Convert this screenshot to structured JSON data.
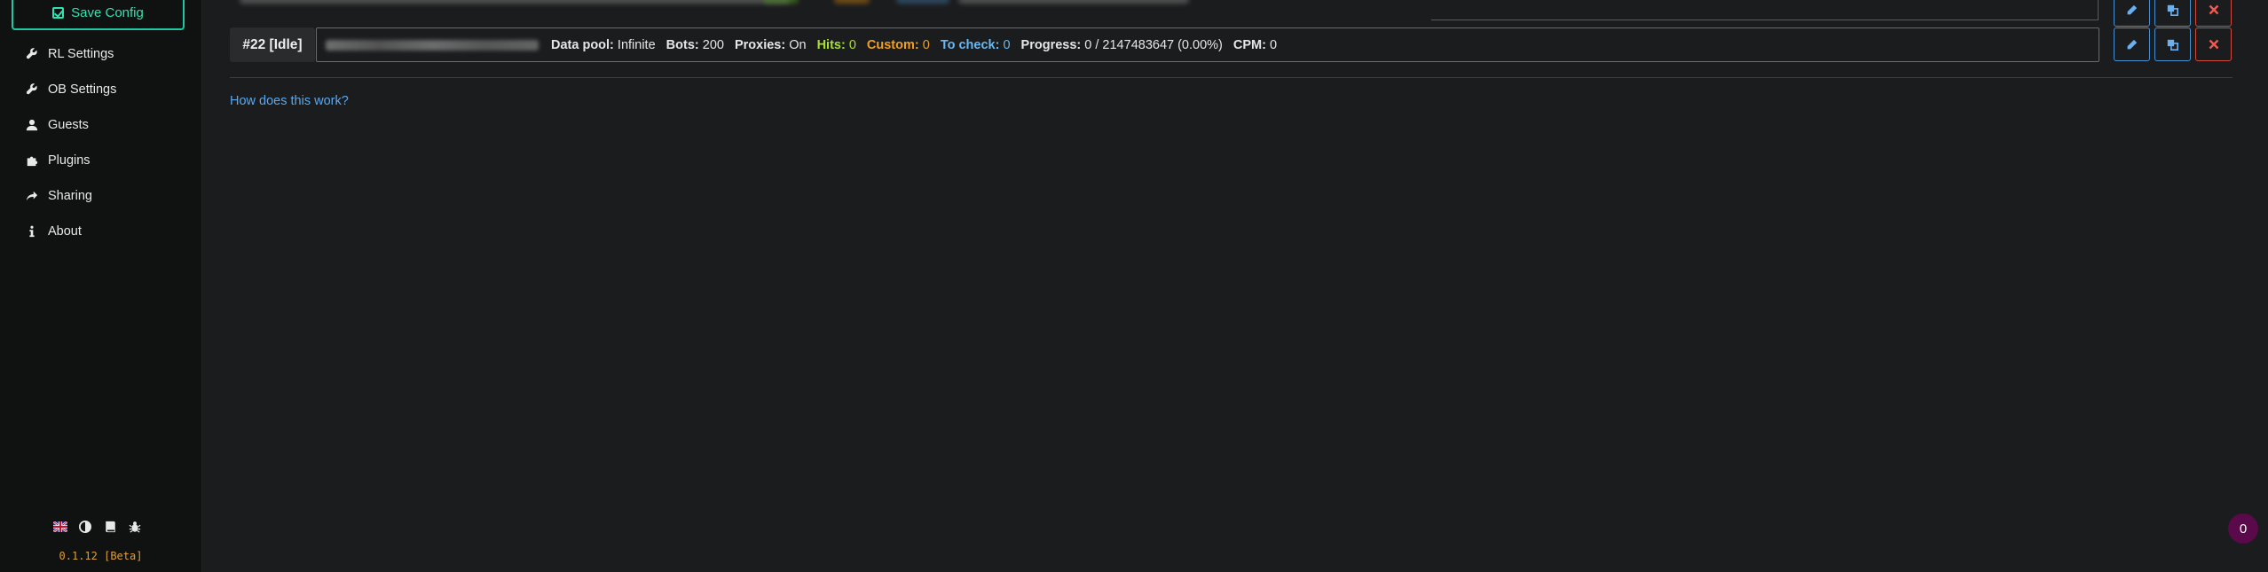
{
  "sidebar": {
    "save_label": "Save Config",
    "items": [
      {
        "label": "RL Settings",
        "icon": "wrench-icon"
      },
      {
        "label": "OB Settings",
        "icon": "wrench-icon"
      },
      {
        "label": "Guests",
        "icon": "user-icon"
      },
      {
        "label": "Plugins",
        "icon": "puzzle-icon"
      },
      {
        "label": "Sharing",
        "icon": "share-icon"
      },
      {
        "label": "About",
        "icon": "info-icon"
      }
    ],
    "footer_icons": [
      "flag-icon",
      "theme-icon",
      "book-icon",
      "bug-icon"
    ],
    "version": "0.1.12 [Beta]"
  },
  "job": {
    "id_label": "#22 [Idle]",
    "data_pool_label": "Data pool:",
    "data_pool_value": "Infinite",
    "bots_label": "Bots:",
    "bots_value": "200",
    "proxies_label": "Proxies:",
    "proxies_value": "On",
    "hits_label": "Hits:",
    "hits_value": "0",
    "custom_label": "Custom:",
    "custom_value": "0",
    "tocheck_label": "To check:",
    "tocheck_value": "0",
    "progress_label": "Progress:",
    "progress_value": "0 / 2147483647 (0.00%)",
    "cpm_label": "CPM:",
    "cpm_value": "0"
  },
  "help_link": "How does this work?",
  "notification_count": "0",
  "colors": {
    "accent": "#1ec8a0",
    "hits": "#a8e030",
    "custom": "#f0a020",
    "tocheck": "#6ab8f0",
    "link": "#5aa8f0",
    "danger": "#d04a40"
  }
}
